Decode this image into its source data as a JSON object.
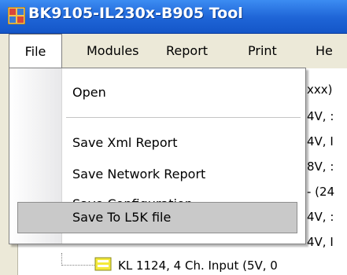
{
  "window": {
    "title": "BK9105-IL230x-B905 Tool",
    "app_icon": "app-grid-icon"
  },
  "menubar": {
    "items": [
      "File",
      "Modules",
      "Report",
      "Print",
      "He"
    ]
  },
  "file_menu": {
    "items": [
      "Open",
      "Save Xml Report",
      "Save Network Report",
      "Save Configuration",
      "Save To L5K file"
    ],
    "highlighted": "Save To L5K file"
  },
  "tree_fragments": [
    "xxx)",
    "4V, :",
    "4V, I",
    "8V, :",
    "- (24",
    "4V, :",
    "4V, I"
  ],
  "tree_bottom": {
    "label": "KL 1124, 4 Ch. Input (5V, 0",
    "icon": "module-icon"
  }
}
